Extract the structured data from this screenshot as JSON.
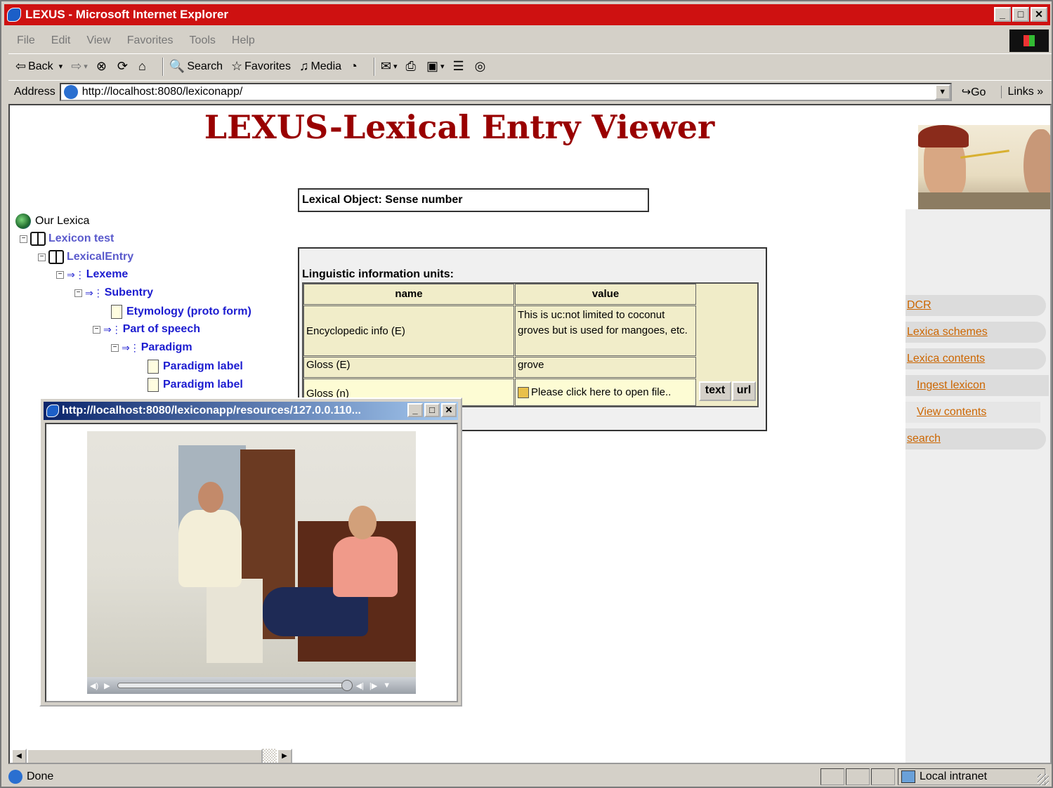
{
  "window": {
    "title": "LEXUS - Microsoft Internet Explorer",
    "controls": {
      "minimize": "_",
      "maximize": "□",
      "close": "✕"
    }
  },
  "menu": [
    "File",
    "Edit",
    "View",
    "Favorites",
    "Tools",
    "Help"
  ],
  "toolbar": {
    "back": "Back",
    "search": "Search",
    "favorites": "Favorites",
    "media": "Media"
  },
  "address": {
    "label": "Address",
    "url": "http://localhost:8080/lexiconapp/",
    "go": "Go",
    "links": "Links"
  },
  "page": {
    "title": "LEXUS-Lexical Entry Viewer",
    "lexical_object": "Lexical Object: Sense number",
    "liu_heading": "Linguistic information units:",
    "table": {
      "headers": [
        "name",
        "value"
      ],
      "rows": [
        {
          "name": "Encyclopedic info (E)",
          "value": "This is uc:not limited to coconut groves but is used for mangoes, etc."
        },
        {
          "name": "Gloss (E)",
          "value": "grove"
        },
        {
          "name": "Gloss (n)",
          "value": "Please click here to open file.."
        }
      ],
      "buttons": {
        "text": "text",
        "url": "url"
      }
    }
  },
  "tree": {
    "root": "Our Lexica",
    "nodes": [
      "Lexicon test",
      "LexicalEntry",
      "Lexeme",
      "Subentry",
      "Etymology (proto form)",
      "Part of speech",
      "Paradigm",
      "Paradigm label",
      "Paradigm label"
    ]
  },
  "nav": {
    "dcr": "DCR",
    "lexica_schemes": "Lexica schemes",
    "lexica_contents": "Lexica contents",
    "ingest_lexicon": "Ingest lexicon",
    "view_contents": "View contents",
    "search": "search"
  },
  "popup": {
    "title": "http://localhost:8080/lexiconapp/resources/127.0.0.110..."
  },
  "status": {
    "text": "Done",
    "zone": "Local intranet"
  }
}
